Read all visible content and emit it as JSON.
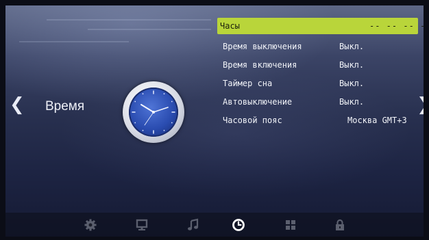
{
  "page": {
    "title": "Время",
    "prev_arrow": "❮",
    "next_arrow": "❯"
  },
  "menu": {
    "items": [
      {
        "label": "Часы",
        "value": "-- -- -- --",
        "selected": true
      },
      {
        "label": "Время выключения",
        "value": "Выкл."
      },
      {
        "label": "Время включения",
        "value": "Выкл."
      },
      {
        "label": "Таймер сна",
        "value": "Выкл."
      },
      {
        "label": "Автовыключение",
        "value": "Выкл."
      },
      {
        "label": "Часовой пояс",
        "value": "Москва GMT+3"
      }
    ]
  },
  "bottom_tabs": [
    {
      "name": "settings-gear-icon",
      "active": false
    },
    {
      "name": "picture-monitor-icon",
      "active": false
    },
    {
      "name": "sound-music-note-icon",
      "active": false
    },
    {
      "name": "time-clock-icon",
      "active": true
    },
    {
      "name": "options-grid-icon",
      "active": false
    },
    {
      "name": "lock-icon",
      "active": false
    }
  ],
  "colors": {
    "highlight": "#b9d53a",
    "active_tab": "#ffffff",
    "inactive_tab": "#5b5f6e"
  }
}
